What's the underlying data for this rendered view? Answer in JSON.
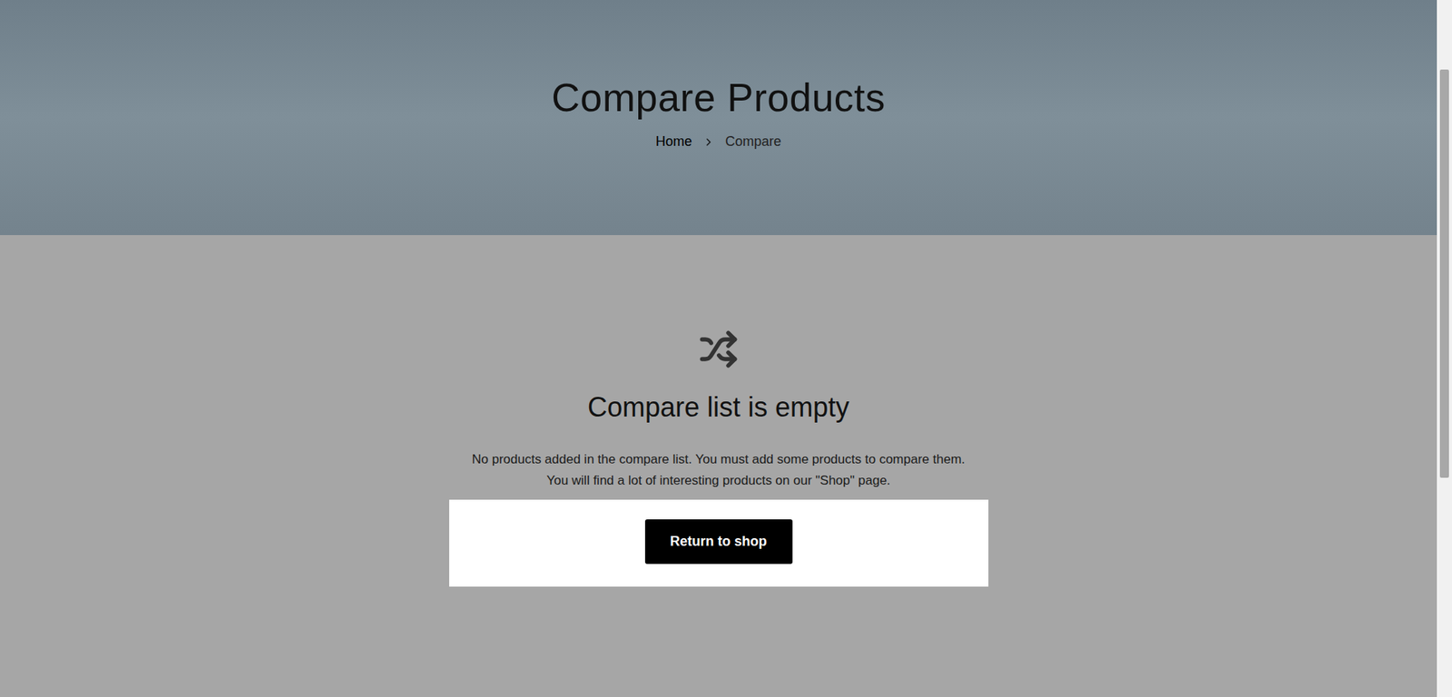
{
  "hero": {
    "title": "Compare Products",
    "breadcrumbs": [
      {
        "label": "Home",
        "current": false
      },
      {
        "label": "Compare",
        "current": true
      }
    ]
  },
  "empty_state": {
    "title": "Compare list is empty",
    "lines": [
      "No products added in the compare list. You must add some products to compare them.",
      "You will find a lot of interesting products on our \"Shop\" page."
    ],
    "button": "Return to shop"
  }
}
